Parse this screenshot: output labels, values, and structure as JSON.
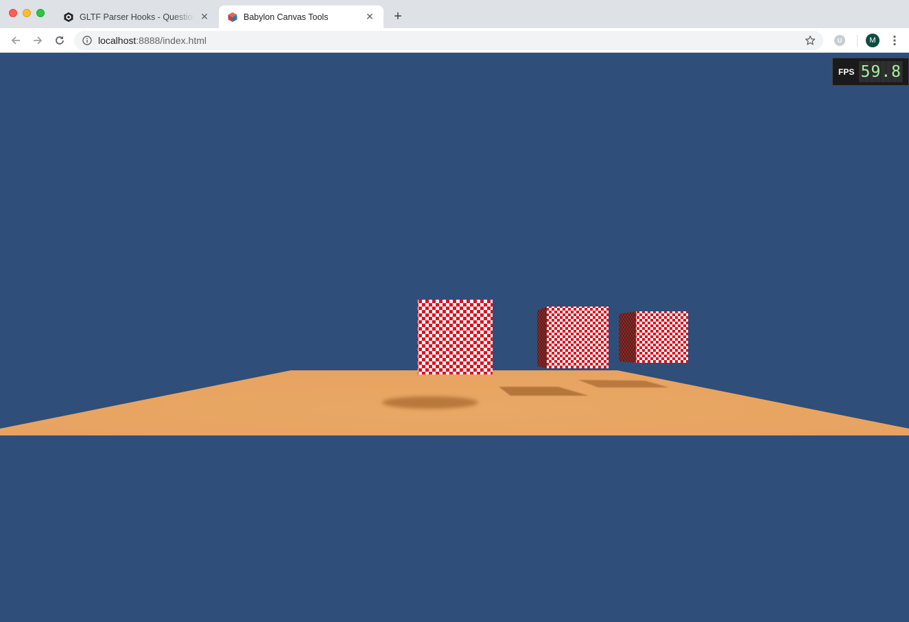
{
  "window": {
    "controls": [
      "close",
      "minimize",
      "maximize"
    ]
  },
  "tabs": [
    {
      "title": "GLTF Parser Hooks - Questions",
      "favicon": "babylon-logo-icon",
      "active": false
    },
    {
      "title": "Babylon Canvas Tools",
      "favicon": "babylon-cube-icon",
      "active": true
    }
  ],
  "toolbar": {
    "url_host": "localhost",
    "url_rest": ":8888/index.html",
    "extension_letter": "U",
    "avatar_letter": "M"
  },
  "fps": {
    "label": "FPS",
    "value": "59.8"
  },
  "scene": {
    "background_color": "#2f4e7a",
    "ground_color": "#e8a663",
    "cube_color_primary": "#e0101e",
    "cube_color_secondary": "#ffffff",
    "cube_count": 3
  }
}
